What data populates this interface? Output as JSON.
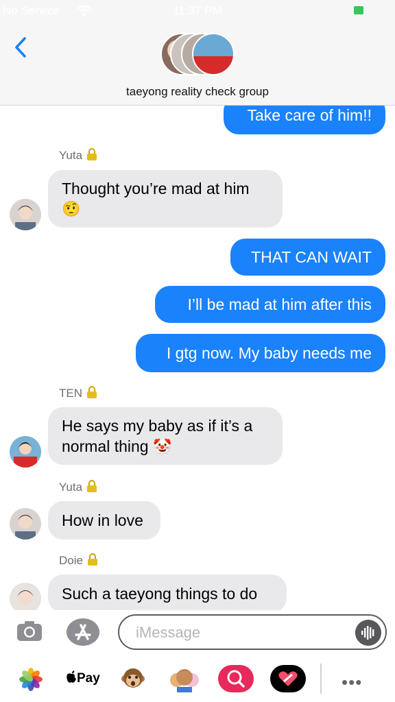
{
  "status_bar": {
    "carrier": "No Service",
    "time": "11:37 PM"
  },
  "header": {
    "group_name": "taeyong reality check group"
  },
  "messages": [
    {
      "type": "out",
      "text": "Take care of him!!"
    },
    {
      "type": "sender",
      "name": "Yuta"
    },
    {
      "type": "in",
      "line1": "Thought you’re mad at him",
      "emoji": "🤨"
    },
    {
      "type": "out",
      "text": "THAT CAN WAIT"
    },
    {
      "type": "out",
      "text": "I’ll be mad at him after this"
    },
    {
      "type": "out",
      "text": "I gtg now. My baby needs me"
    },
    {
      "type": "sender",
      "name": "TEN"
    },
    {
      "type": "in",
      "line1": "He says my baby as if it’s a",
      "line2": "normal thing",
      "emoji": "🤡"
    },
    {
      "type": "sender",
      "name": "Yuta"
    },
    {
      "type": "in",
      "text": "How in love"
    },
    {
      "type": "sender",
      "name": "Doie"
    },
    {
      "type": "in",
      "text": "Such a taeyong things to do"
    }
  ],
  "input": {
    "placeholder": "iMessage"
  },
  "app_tray": {
    "apple_pay": "Pay",
    "more": "•••"
  },
  "colors": {
    "outgoing": "#1a82fb",
    "incoming": "#e9e9eb",
    "header_bg": "#f6f6f6"
  }
}
